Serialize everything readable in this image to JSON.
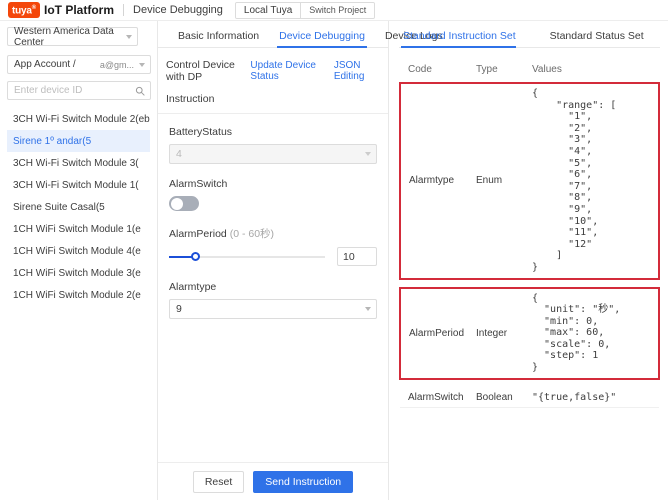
{
  "topbar": {
    "logo_text": "tuya",
    "logo_sup": "®",
    "brand": "IoT Platform",
    "page_title": "Device Debugging",
    "local_button": "Local Tuya",
    "switch_project_button": "Switch Project"
  },
  "sidebar": {
    "data_center": "Western America Data Center",
    "account_label": "App Account /",
    "account_value": "a@gm...",
    "search_placeholder": "Enter device ID",
    "search_value": "",
    "search_icon": "search-icon",
    "devices": [
      {
        "label": "3CH Wi-Fi Switch Module 2(eb",
        "selected": false
      },
      {
        "label": "Sirene 1º andar(5",
        "selected": true
      },
      {
        "label": "3CH Wi-Fi Switch Module 3(",
        "selected": false
      },
      {
        "label": "3CH Wi-Fi Switch Module 1(",
        "selected": false
      },
      {
        "label": "Sirene Suite Casal(5",
        "selected": false
      },
      {
        "label": "1CH WiFi Switch Module 1(e",
        "selected": false
      },
      {
        "label": "1CH WiFi Switch Module 4(e",
        "selected": false
      },
      {
        "label": "1CH WiFi Switch Module 3(e",
        "selected": false
      },
      {
        "label": "1CH WiFi Switch Module 2(e",
        "selected": false
      }
    ]
  },
  "center": {
    "tabs": [
      {
        "label": "Basic Information",
        "active": false
      },
      {
        "label": "Device Debugging",
        "active": true
      },
      {
        "label": "Device Logs",
        "active": false
      }
    ],
    "control_title": "Control Device with DP",
    "link_update_status": "Update Device Status",
    "link_json_editing": "JSON Editing",
    "instruction_label": "Instruction",
    "fields": {
      "battery_status": {
        "label": "BatteryStatus",
        "value": "4",
        "disabled": true
      },
      "alarm_switch": {
        "label": "AlarmSwitch",
        "state": "off"
      },
      "alarm_period": {
        "label": "AlarmPeriod",
        "hint": "(0 - 60秒)",
        "value": "10",
        "min": 0,
        "max": 60,
        "percent": 17
      },
      "alarm_type": {
        "label": "Alarmtype",
        "value": "9",
        "disabled": false
      }
    },
    "footer": {
      "reset_label": "Reset",
      "send_label": "Send Instruction"
    }
  },
  "right": {
    "tabs": [
      {
        "label": "Standard Instruction Set",
        "active": true
      },
      {
        "label": "Standard Status Set",
        "active": false
      }
    ],
    "columns": {
      "code": "Code",
      "type": "Type",
      "values": "Values"
    },
    "rows": [
      {
        "code": "Alarmtype",
        "type": "Enum",
        "values": "{\n    \"range\": [\n      \"1\",\n      \"2\",\n      \"3\",\n      \"4\",\n      \"5\",\n      \"6\",\n      \"7\",\n      \"8\",\n      \"9\",\n      \"10\",\n      \"11\",\n      \"12\"\n    ]\n}",
        "highlight": true
      },
      {
        "code": "AlarmPeriod",
        "type": "Integer",
        "values": "{\n  \"unit\": \"秒\",\n  \"min\": 0,\n  \"max\": 60,\n  \"scale\": 0,\n  \"step\": 1\n}",
        "highlight": true
      },
      {
        "code": "AlarmSwitch",
        "type": "Boolean",
        "values": "\"{true,false}\"",
        "highlight": false
      }
    ]
  },
  "colors": {
    "brand_orange": "#f4470b",
    "primary_blue": "#2f72e8",
    "slider_blue": "#1b4fd8",
    "highlight_red": "#d32b3a"
  }
}
